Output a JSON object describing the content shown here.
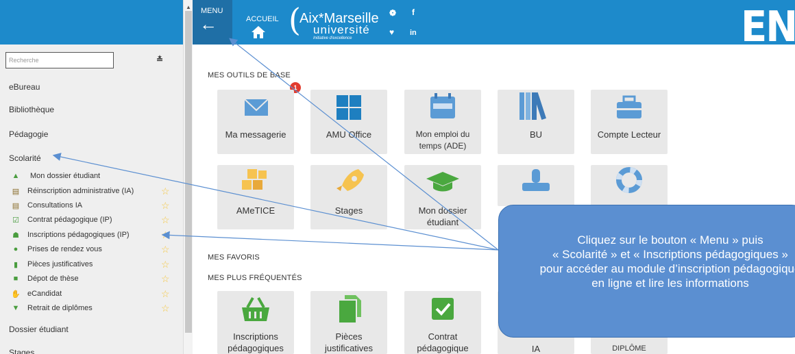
{
  "topbar": {
    "menu_label": "MENU",
    "accueil_label": "ACCUEIL",
    "logo_line1": "Aix*Marseille",
    "logo_line2": "université",
    "logo_line3": "Initiative d'excellence",
    "brand": "ENT"
  },
  "sidebar": {
    "search_placeholder": "Recherche",
    "items": [
      {
        "label": "eBureau"
      },
      {
        "label": "Bibliothèque"
      },
      {
        "label": "Pédagogie"
      },
      {
        "label": "Scolarité"
      }
    ],
    "sub_items": [
      {
        "label": "Mon dossier étudiant",
        "icon": "graduation-cap-icon"
      },
      {
        "label": "Réinscription administrative (IA)",
        "icon": "institution-icon"
      },
      {
        "label": "Consultations IA",
        "icon": "institution-icon"
      },
      {
        "label": "Contrat pédagogique (IP)",
        "icon": "check-square-icon"
      },
      {
        "label": "Inscriptions pédagogiques (IP)",
        "icon": "basket-icon"
      },
      {
        "label": "Prises de rendez vous",
        "icon": "users-icon"
      },
      {
        "label": "Pièces justificatives",
        "icon": "files-icon"
      },
      {
        "label": "Dépot de thèse",
        "icon": "book-icon"
      },
      {
        "label": "eCandidat",
        "icon": "hand-icon"
      },
      {
        "label": "Retrait de diplômes",
        "icon": "trophy-icon"
      }
    ],
    "bottom_items": [
      {
        "label": "Dossier étudiant"
      },
      {
        "label": "Stages"
      }
    ]
  },
  "main": {
    "section_base": "MES OUTILS DE BASE",
    "section_favoris": "MES FAVORIS",
    "section_frequents": "MES PLUS FRÉQUENTÉS",
    "badge_count": "1",
    "tiles_row1": [
      {
        "label": "Ma messagerie"
      },
      {
        "label": "AMU Office"
      },
      {
        "label": "Mon emploi du temps (ADE)"
      },
      {
        "label": "BU"
      },
      {
        "label": "Compte Lecteur"
      }
    ],
    "tiles_row2": [
      {
        "label": "AMeTICE"
      },
      {
        "label": "Stages"
      },
      {
        "label": "Mon dossier étudiant"
      },
      {
        "label": ""
      },
      {
        "label": ""
      }
    ],
    "tiles_row3": [
      {
        "label": "Inscriptions pédagogiques"
      },
      {
        "label": "Pièces justificatives"
      },
      {
        "label": "Contrat pédagogique"
      },
      {
        "label": "IA"
      },
      {
        "label": "DIPLÔME"
      }
    ]
  },
  "callout": {
    "line1": "Cliquez sur le bouton « Menu » puis",
    "line2": "« Scolarité » et « Inscriptions pédagogiques »",
    "line3": "pour accéder au module d’inscription pédagogique",
    "line4": "en ligne et lire les informations"
  },
  "colors": {
    "brand_blue": "#1d8acb",
    "menu_dark_blue": "#1f6fa6",
    "callout_blue": "#5b8fd1",
    "tile_gray": "#e8e8e8",
    "badge_red": "#e23b2e",
    "star_yellow": "#f5c842"
  }
}
